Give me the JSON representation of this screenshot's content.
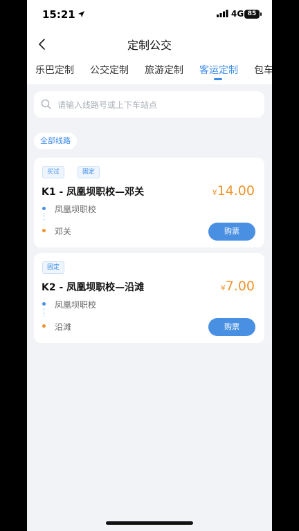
{
  "status": {
    "time": "15:21",
    "network": "4G",
    "battery": "85"
  },
  "nav": {
    "title": "定制公交"
  },
  "tabs": [
    {
      "label": "乐巴定制"
    },
    {
      "label": "公交定制"
    },
    {
      "label": "旅游定制"
    },
    {
      "label": "客运定制"
    },
    {
      "label": "包车"
    }
  ],
  "active_tab": "客运定制",
  "search": {
    "placeholder": "请输入线路号或上下车站点"
  },
  "filter": {
    "label": "全部线路"
  },
  "routes": [
    {
      "tags": [
        "买过",
        "固定"
      ],
      "name": "K1 - 凤凰坝职校—邓关",
      "currency": "¥",
      "price": "14.00",
      "from": "凤凰坝职校",
      "to": "邓关",
      "button": "购票"
    },
    {
      "tags": [
        "固定"
      ],
      "name": "K2 - 凤凰坝职校—沿滩",
      "currency": "¥",
      "price": "7.00",
      "from": "凤凰坝职校",
      "to": "沿滩",
      "button": "购票"
    }
  ],
  "colors": {
    "accent": "#3a8be8",
    "price": "#f0932b",
    "background": "#f1f3f6"
  }
}
